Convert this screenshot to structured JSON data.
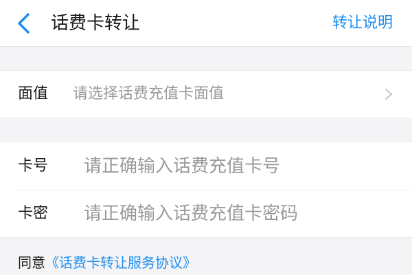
{
  "header": {
    "title": "话费卡转让",
    "help_label": "转让说明",
    "back_icon": "chevron-left-icon",
    "accent_color": "#1e8ef0"
  },
  "face_value": {
    "label": "面值",
    "placeholder": "请选择话费充值卡面值",
    "chevron_icon": "chevron-right-icon"
  },
  "card_form": {
    "card_number": {
      "label": "卡号",
      "value": "",
      "placeholder": "请正确输入话费充值卡号"
    },
    "card_password": {
      "label": "卡密",
      "value": "",
      "placeholder": "请正确输入话费充值卡密码"
    }
  },
  "agreement": {
    "prefix": "同意",
    "link_text": "《话费卡转让服务协议》"
  }
}
